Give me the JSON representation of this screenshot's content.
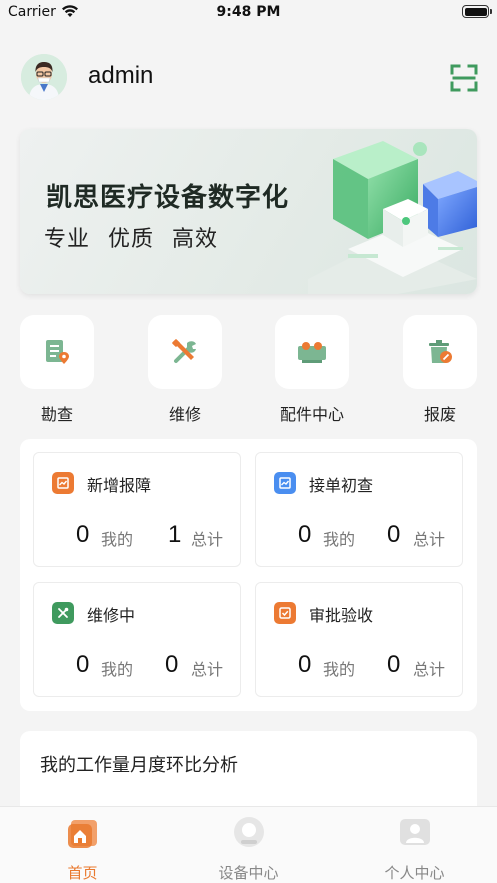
{
  "status_bar": {
    "carrier": "Carrier",
    "time": "9:48 PM"
  },
  "header": {
    "username": "admin"
  },
  "banner": {
    "title": "凯思医疗设备数字化",
    "subtitle": "专业 优质 高效"
  },
  "quick_entries": [
    {
      "label": "勘查",
      "icon": "survey-icon"
    },
    {
      "label": "维修",
      "icon": "repair-tools-icon"
    },
    {
      "label": "配件中心",
      "icon": "parts-icon"
    },
    {
      "label": "报废",
      "icon": "scrap-bin-icon"
    }
  ],
  "stats": [
    {
      "title": "新增报障",
      "mine": "0",
      "mine_label": "我的",
      "total": "1",
      "total_label": "总计",
      "color": "#ec7a33",
      "icon": "chart-icon"
    },
    {
      "title": "接单初查",
      "mine": "0",
      "mine_label": "我的",
      "total": "0",
      "total_label": "总计",
      "color": "#4a8ef0",
      "icon": "chart-icon"
    },
    {
      "title": "维修中",
      "mine": "0",
      "mine_label": "我的",
      "total": "0",
      "total_label": "总计",
      "color": "#3f9a5e",
      "icon": "tools-icon"
    },
    {
      "title": "审批验收",
      "mine": "0",
      "mine_label": "我的",
      "total": "0",
      "total_label": "总计",
      "color": "#ec7a33",
      "icon": "check-icon"
    }
  ],
  "analysis": {
    "title": "我的工作量月度环比分析"
  },
  "tabs": [
    {
      "label": "首页",
      "active": true
    },
    {
      "label": "设备中心",
      "active": false
    },
    {
      "label": "个人中心",
      "active": false
    }
  ],
  "colors": {
    "accent": "#e9792e",
    "brand_green": "#3f9a5e",
    "inactive": "#888888"
  }
}
